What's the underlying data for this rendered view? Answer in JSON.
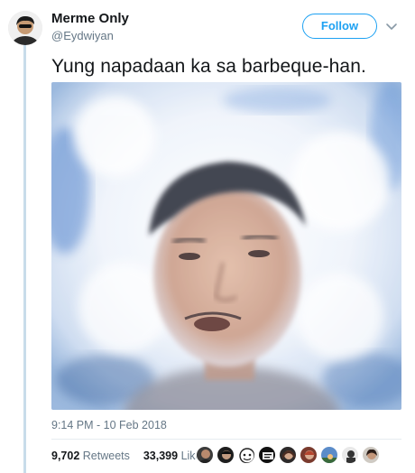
{
  "tweet": {
    "display_name": "Merme Only",
    "handle": "@Eydwiyan",
    "follow_label": "Follow",
    "text": "Yung napadaan ka sa barbeque-han.",
    "timestamp": "9:14 PM - 10 Feb 2018",
    "retweets_count": "9,702",
    "retweets_label": "Retweets",
    "likes_count": "33,399",
    "likes_label": "Likes"
  },
  "colors": {
    "accent": "#1da1f2",
    "secondary_text": "#657786",
    "thread_line": "#c8dcea"
  },
  "icons": [
    "chevron-down-icon"
  ]
}
